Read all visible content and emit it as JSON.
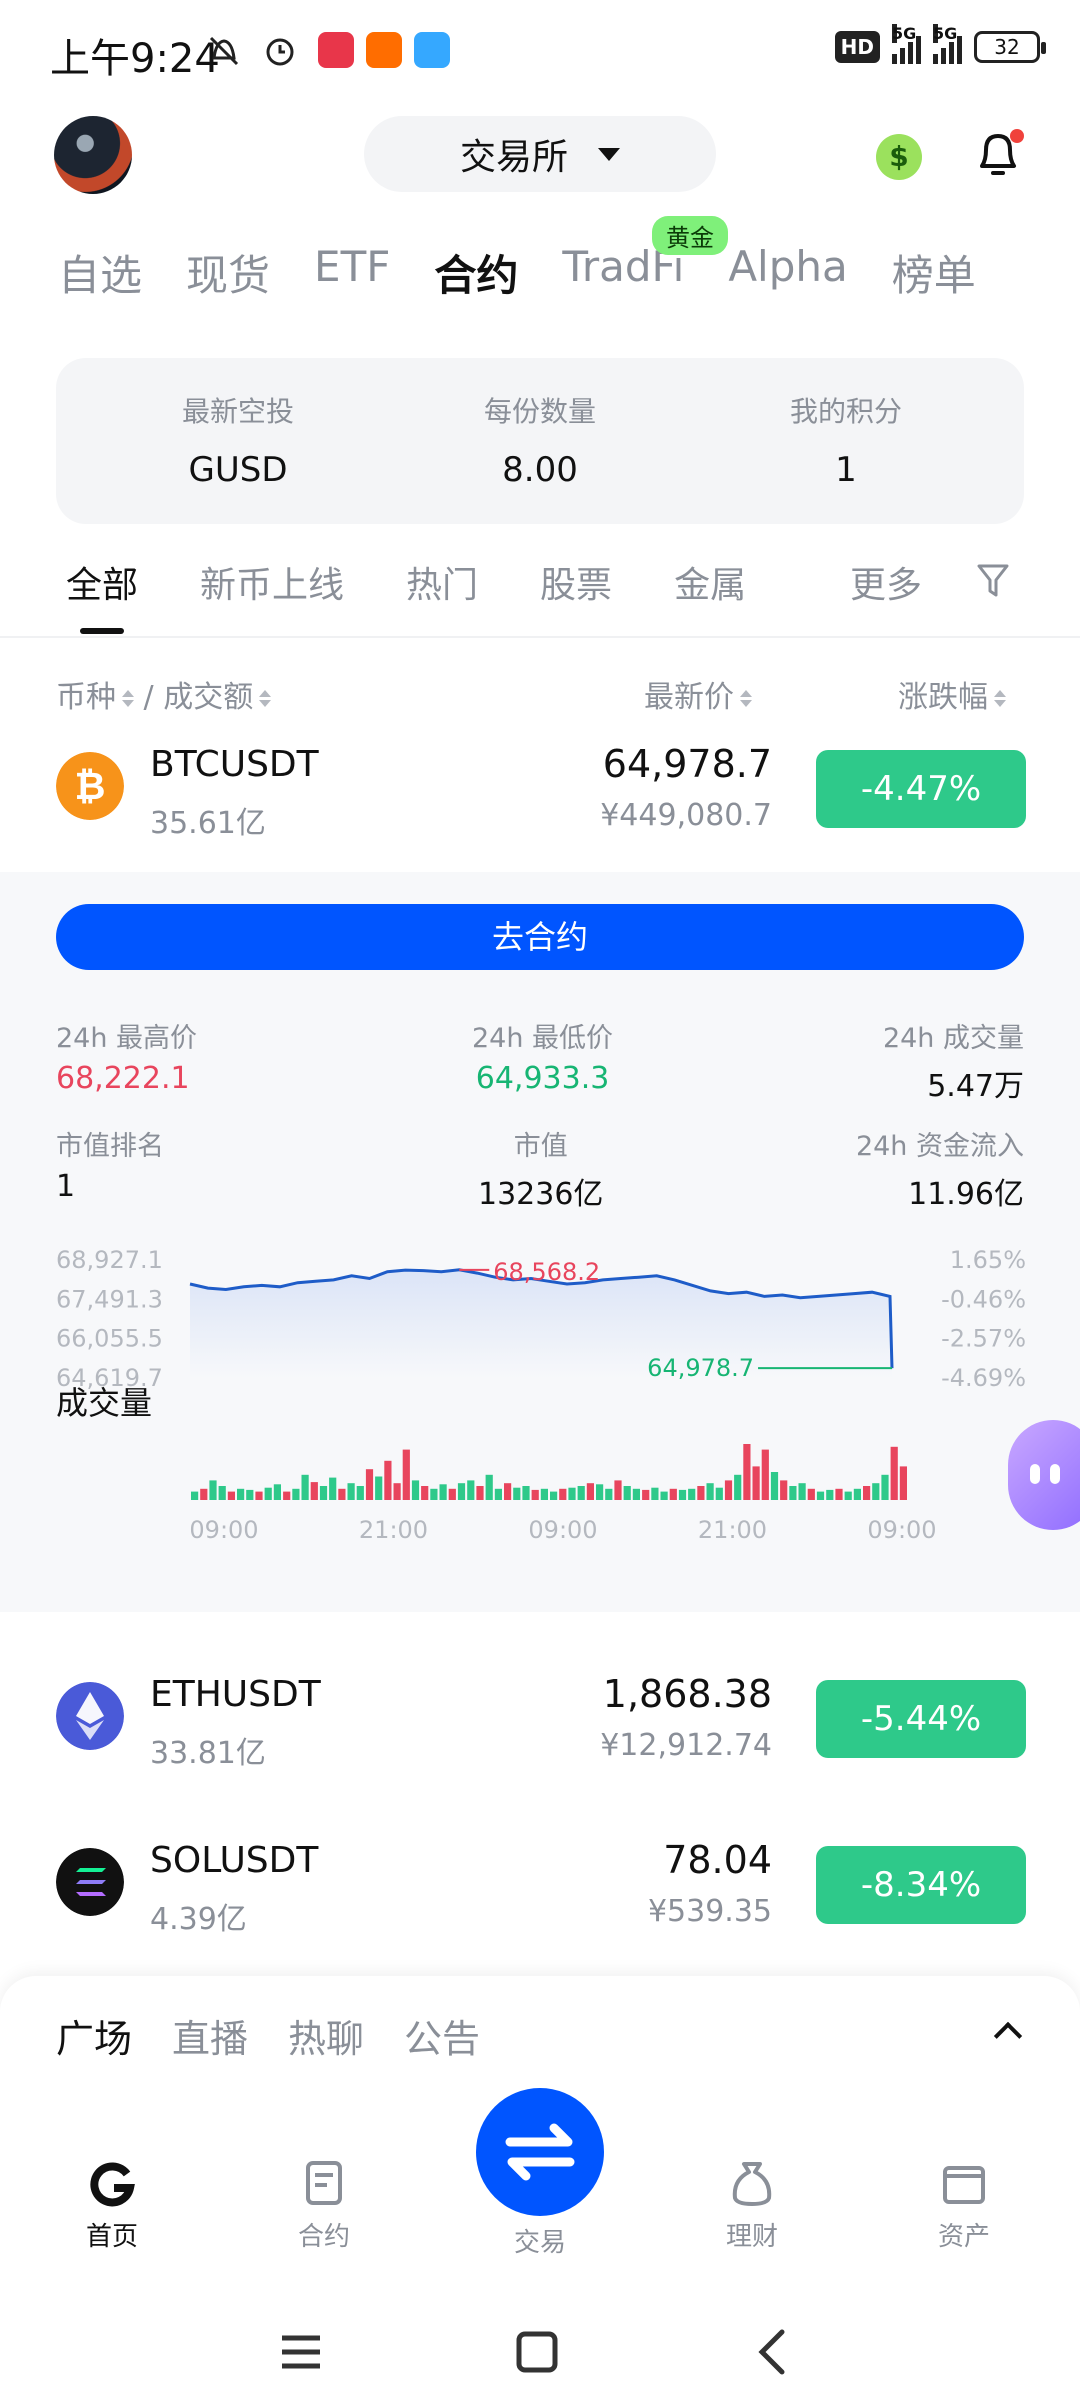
{
  "status_bar": {
    "time": "上午9:24",
    "hd": "HD",
    "net1": "5G",
    "net2": "5G",
    "battery": "32"
  },
  "header": {
    "exchange_label": "交易所"
  },
  "top_tabs": [
    "自选",
    "现货",
    "ETF",
    "合约",
    "TradFi",
    "Alpha",
    "榜单"
  ],
  "top_tabs_active": "合约",
  "tradfi_badge": "黄金",
  "airdrop": {
    "cols": [
      {
        "label": "最新空投",
        "value": "GUSD"
      },
      {
        "label": "每份数量",
        "value": "8.00"
      },
      {
        "label": "我的积分",
        "value": "1"
      }
    ]
  },
  "category_tabs": [
    "全部",
    "新币上线",
    "热门",
    "股票",
    "金属"
  ],
  "category_more": "更多",
  "list_header": {
    "coin": "币种",
    "sep": "/",
    "turnover": "成交额",
    "price": "最新价",
    "change": "涨跌幅"
  },
  "rows": [
    {
      "symbol": "BTCUSDT",
      "volume": "35.61亿",
      "price": "64,978.7",
      "cny": "¥449,080.7",
      "change": "-4.47%"
    },
    {
      "symbol": "ETHUSDT",
      "volume": "33.81亿",
      "price": "1,868.38",
      "cny": "¥12,912.74",
      "change": "-5.44%"
    },
    {
      "symbol": "SOLUSDT",
      "volume": "4.39亿",
      "price": "78.04",
      "cny": "¥539.35",
      "change": "-8.34%"
    }
  ],
  "panel": {
    "go_button": "去合约",
    "high_label": "24h 最高价",
    "high_value": "68,222.1",
    "low_label": "24h 最低价",
    "low_value": "64,933.3",
    "vol_label": "24h 成交量",
    "vol_value": "5.47万",
    "rank_label": "市值排名",
    "rank_value": "1",
    "mcap_label": "市值",
    "mcap_value": "13236亿",
    "inflow_label": "24h 资金流入",
    "inflow_value": "11.96亿",
    "volume_label": "成交量"
  },
  "chart_data": {
    "type": "line",
    "y_ticks_left": [
      "68,927.1",
      "67,491.3",
      "66,055.5",
      "64,619.7"
    ],
    "y_ticks_right": [
      "1.65%",
      "-0.46%",
      "-2.57%",
      "-4.69%"
    ],
    "x_ticks": [
      "09:00",
      "21:00",
      "09:00",
      "21:00",
      "09:00"
    ],
    "high_annotation": "68,568.2",
    "last_annotation": "64,978.7",
    "ylim": [
      64619.7,
      68927.1
    ],
    "price_series": [
      68050,
      67900,
      67850,
      67950,
      68000,
      67950,
      68100,
      68150,
      68200,
      68350,
      68250,
      68500,
      68560,
      68540,
      68500,
      68568,
      68450,
      68300,
      68200,
      68250,
      68150,
      68050,
      68100,
      68200,
      68250,
      68300,
      68350,
      68200,
      68000,
      67800,
      67700,
      67750,
      67600,
      67650,
      67550,
      67600,
      67650,
      67700,
      67750,
      67600,
      64978
    ],
    "volume_series": [
      0.15,
      0.2,
      0.35,
      0.25,
      0.15,
      0.2,
      0.18,
      0.15,
      0.22,
      0.28,
      0.15,
      0.2,
      0.45,
      0.32,
      0.25,
      0.4,
      0.2,
      0.3,
      0.25,
      0.55,
      0.42,
      0.7,
      0.3,
      0.9,
      0.35,
      0.25,
      0.2,
      0.28,
      0.2,
      0.3,
      0.35,
      0.25,
      0.45,
      0.2,
      0.3,
      0.22,
      0.25,
      0.18,
      0.2,
      0.15,
      0.2,
      0.22,
      0.25,
      0.3,
      0.28,
      0.2,
      0.35,
      0.25,
      0.2,
      0.18,
      0.22,
      0.15,
      0.2,
      0.18,
      0.2,
      0.25,
      0.3,
      0.22,
      0.35,
      0.45,
      1.0,
      0.6,
      0.9,
      0.5,
      0.35,
      0.25,
      0.3,
      0.2,
      0.15,
      0.18,
      0.2,
      0.15,
      0.2,
      0.25,
      0.3,
      0.45,
      0.95,
      0.6
    ]
  },
  "bottom_sheet": {
    "tabs": [
      "广场",
      "直播",
      "热聊",
      "公告"
    ]
  },
  "nav": {
    "home": "首页",
    "futures": "合约",
    "trade": "交易",
    "earn": "理财",
    "assets": "资产"
  },
  "colors": {
    "accent": "#0055ff",
    "down": "#2ec98a",
    "high": "#e8455d",
    "low": "#17b573",
    "gold_badge": "#7ff07a"
  }
}
